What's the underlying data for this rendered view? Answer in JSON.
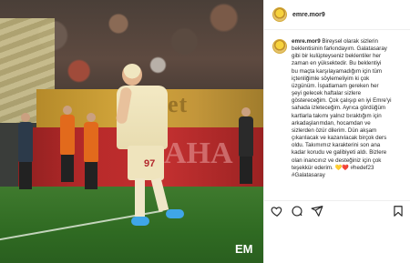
{
  "post": {
    "username": "emre.mor9",
    "caption_user": "emre.mor9",
    "caption_text": "Bireysel olarak sizlerin\nbeklentisinin farkındayım. Galatasaray\ngibi bir kulüpteyseniz beklentiler her\nzaman en yüksektedir. Bu beklentiyi\nbu maçta karşılayamadığım için tüm\niçtenliğimle söylemeliyim ki çok\nüzgünüm. İspatlamam gereken her\nşeyi gelecek haftalar sizlere\ngöstereceğim. Çok çalışıp en iyi Emre'yi\nsahada izleteceğim. Ayrıca gördüğüm\nkartlarla takımı yalnız bıraktığım için\narkadaşlarımdan, hocamdan ve\nsizlerden özür dilerim. Dün akşam\nçıkarılacak ve kazanılacak birçok ders\noldu. Takımımız karakterini son ana\nkadar korudu ve galibiyeti aldı. Bizlere\nolan inancınız ve desteğiniz için çok\nteşekkür ederim. 💛❤️ #hedef23\n#Galatasaray"
  },
  "photo": {
    "player_number": "97",
    "banner_text": "Teket",
    "wall_text": "AHA",
    "watermark": "EM"
  },
  "icons": {
    "like": "heart-icon",
    "comment": "comment-icon",
    "share": "share-icon",
    "save": "bookmark-icon"
  }
}
